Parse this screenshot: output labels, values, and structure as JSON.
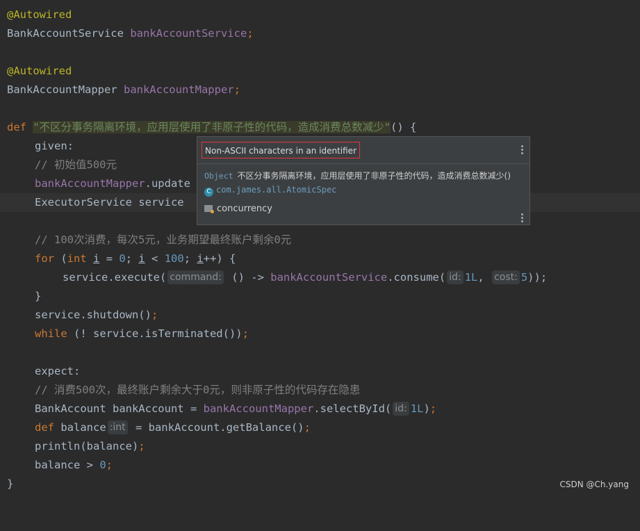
{
  "code": {
    "l1": "@Autowired",
    "l2_type": "BankAccountService",
    "l2_field": "bankAccountService",
    "l2_semi": ";",
    "l4": "@Autowired",
    "l5_type": "BankAccountMapper",
    "l5_field": "bankAccountMapper",
    "l5_semi": ";",
    "l7_kw": "def",
    "l7_name": "\"不区分事务隔离环境，应用层使用了非原子性的代码，造成消费总数减少\"",
    "l7_tail": "() {",
    "l8": "given:",
    "l9": "// 初始值500元",
    "l10_field": "bankAccountMapper",
    "l10_rest": ".update",
    "l11": "ExecutorService service",
    "l13": "// 100次消费，每次5元，业务期望最终账户剩余0元",
    "l14_for": "for",
    "l14_p1": " (",
    "l14_int": "int",
    "l14_sp": " ",
    "l14_i1": "i",
    "l14_eq": " = ",
    "l14_zero": "0",
    "l14_semi1": "; ",
    "l14_i2": "i",
    "l14_lt": " < ",
    "l14_hundred": "100",
    "l14_semi2": "; ",
    "l14_i3": "i",
    "l14_end": "++) {",
    "l15_a": "service.execute(",
    "l15_hint": "command:",
    "l15_b": " () -> ",
    "l15_field": "bankAccountService",
    "l15_c": ".consume(",
    "l15_hint_id": "id:",
    "l15_id": "1L",
    "l15_comma": ", ",
    "l15_hint_cost": "cost:",
    "l15_cost": "5",
    "l15_end": "));",
    "l16": "}",
    "l17_a": "service.shutdown()",
    "l17_semi": ";",
    "l18_kw": "while",
    "l18_a": " (! service.isTerminated())",
    "l18_semi": ";",
    "l20": "expect:",
    "l21": "// 消费500次，最终账户剩余大于0元，则非原子性的代码存在隐患",
    "l22_a": "BankAccount bankAccount = ",
    "l22_field": "bankAccountMapper",
    "l22_b": ".selectById(",
    "l22_hint": "id:",
    "l22_val": "1L",
    "l22_end": ")",
    "l22_semi": ";",
    "l23_kw": "def",
    "l23_a": " balance",
    "l23_hint": ":int",
    "l23_b": " = bankAccount.getBalance()",
    "l23_semi": ";",
    "l24_a": "println(balance)",
    "l24_semi": ";",
    "l25_a": "balance > ",
    "l25_num": "0",
    "l25_semi": ";",
    "l26": "}"
  },
  "popup": {
    "problem": "Non-ASCII characters in an identifier",
    "sig_prefix": "Object",
    "sig_name": "不区分事务隔离环境，应用层使用了非原子性的代码，造成消费总数减少()",
    "class_icon": "C",
    "class_name": "com.james.all.AtomicSpec",
    "package": "concurrency"
  },
  "icons": {
    "more_top": "more-vertical-icon",
    "more_bottom": "more-vertical-icon",
    "class": "class-icon",
    "package": "package-folder-icon"
  },
  "watermark": "CSDN @Ch.yang"
}
